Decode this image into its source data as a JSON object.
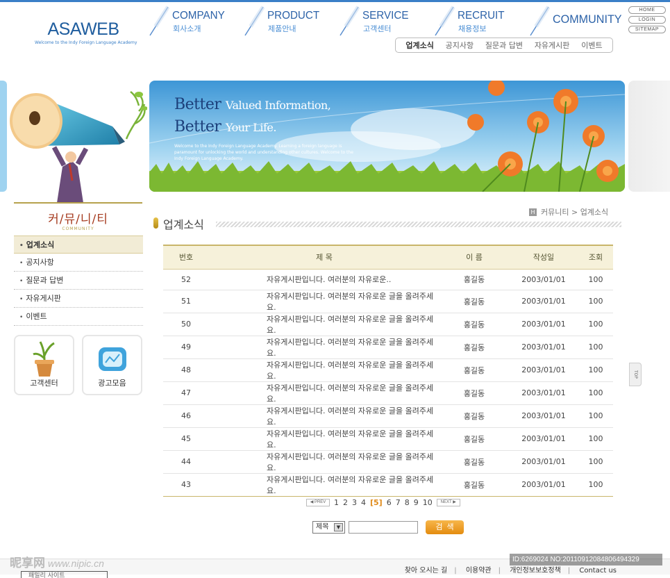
{
  "logo": {
    "name": "ASAWEB",
    "tagline": "Welcome to the Indy Foreign Language Academy"
  },
  "gnb": [
    {
      "en": "COMPANY",
      "ko": "회사소개"
    },
    {
      "en": "PRODUCT",
      "ko": "제품안내"
    },
    {
      "en": "SERVICE",
      "ko": "고객센터"
    },
    {
      "en": "RECRUIT",
      "ko": "채용정보"
    },
    {
      "en": "COMMUNITY",
      "ko": ""
    }
  ],
  "util": [
    "HOME",
    "LOGIN",
    "SITEMAP"
  ],
  "subnav": [
    "업계소식",
    "공지사항",
    "질문과 답변",
    "자유게시판",
    "이벤트"
  ],
  "banner": {
    "line1_big": "Better",
    "line1_small": "Valued Information,",
    "line2_big": "Better",
    "line2_small": "Your Life.",
    "small_text": "Welcome to the Indy Foreign Language Academy. Learning a foreign language is paramount for unlocking the world and understanding other cultures. Welcome to the Indy Foreign Language Academy."
  },
  "lnb": {
    "title": "커/뮤/니/티",
    "subtitle": "COMMUNITY",
    "items": [
      "업계소식",
      "공지사항",
      "질문과 답변",
      "자유게시판",
      "이벤트"
    ]
  },
  "quick": [
    "고객센터",
    "광고모음"
  ],
  "page": {
    "title": "업계소식"
  },
  "location": {
    "home": "H",
    "path": "커뮤니티 > 업계소식"
  },
  "board": {
    "headers": [
      "번호",
      "제 목",
      "이 름",
      "작성일",
      "조회"
    ],
    "rows": [
      {
        "no": "52",
        "subject": "자유게시판입니다. 여러분의 자유로운..",
        "name": "홍길동",
        "date": "2003/01/01",
        "hits": "100"
      },
      {
        "no": "51",
        "subject": "자유게시판입니다. 여러분의 자유로운 글을 올려주세요.",
        "name": "홍길동",
        "date": "2003/01/01",
        "hits": "100"
      },
      {
        "no": "50",
        "subject": "자유게시판입니다. 여러분의 자유로운 글을 올려주세요.",
        "name": "홍길동",
        "date": "2003/01/01",
        "hits": "100"
      },
      {
        "no": "49",
        "subject": "자유게시판입니다. 여러분의 자유로운 글을 올려주세요.",
        "name": "홍길동",
        "date": "2003/01/01",
        "hits": "100"
      },
      {
        "no": "48",
        "subject": "자유게시판입니다. 여러분의 자유로운 글을 올려주세요.",
        "name": "홍길동",
        "date": "2003/01/01",
        "hits": "100"
      },
      {
        "no": "47",
        "subject": "자유게시판입니다. 여러분의 자유로운 글을 올려주세요.",
        "name": "홍길동",
        "date": "2003/01/01",
        "hits": "100"
      },
      {
        "no": "46",
        "subject": "자유게시판입니다. 여러분의 자유로운 글을 올려주세요.",
        "name": "홍길동",
        "date": "2003/01/01",
        "hits": "100"
      },
      {
        "no": "45",
        "subject": "자유게시판입니다. 여러분의 자유로운 글을 올려주세요.",
        "name": "홍길동",
        "date": "2003/01/01",
        "hits": "100"
      },
      {
        "no": "44",
        "subject": "자유게시판입니다. 여러분의 자유로운 글을 올려주세요.",
        "name": "홍길동",
        "date": "2003/01/01",
        "hits": "100"
      },
      {
        "no": "43",
        "subject": "자유게시판입니다. 여러분의 자유로운 글을 올려주세요.",
        "name": "홍길동",
        "date": "2003/01/01",
        "hits": "100"
      }
    ]
  },
  "pager": {
    "prev": "PREV",
    "next": "NEXT",
    "pages": [
      "1",
      "2",
      "3",
      "4",
      "[5]",
      "6",
      "7",
      "8",
      "9",
      "10"
    ]
  },
  "search": {
    "select_value": "제목",
    "button": "검색"
  },
  "top_tab": "TOP",
  "footer": {
    "links": [
      "찾아 오시는 길",
      "이용약관",
      "개인정보보호정책",
      "Contact us"
    ],
    "select_value": "패밀리 사이트"
  },
  "watermark": {
    "site": "昵享网",
    "url": "www.nipic.cn",
    "id": "ID:6269024 NO:20110912084806494329"
  },
  "colors": {
    "brand_blue": "#2c62a8",
    "gold": "#b6a14c",
    "orange": "#e48c10"
  }
}
